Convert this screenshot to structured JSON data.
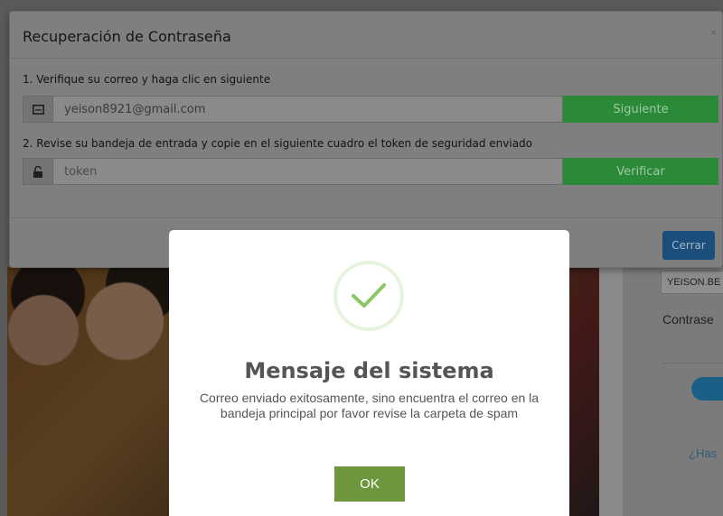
{
  "background": {
    "username": "YEISON.BE",
    "password_label": "Contrase",
    "link_text": "¿Has"
  },
  "recovery_modal": {
    "title": "Recuperación de Contraseña",
    "close_glyph": "×",
    "step1_label": "1. Verifique su correo y haga clic en siguiente",
    "email_value": "yeison8921@gmail.com",
    "next_button": "Siguiente",
    "step2_label": "2. Revise su bandeja de entrada y copie en el siguiente cuadro el token de seguridad enviado",
    "token_placeholder": "token",
    "verify_button": "Verificar",
    "close_button": "Cerrar",
    "icons": [
      "envelope-icon",
      "unlock-icon"
    ]
  },
  "alert": {
    "icon": "success-check-icon",
    "title": "Mensaje del sistema",
    "message": "Correo enviado exitosamente, sino encuentra el correo en la bandeja principal por favor revise la carpeta de spam",
    "ok_button": "OK"
  },
  "colors": {
    "accent_green": "#6e963c",
    "verify_green": "#2a8a37",
    "close_blue": "#1b4e7b",
    "check_green": "#8cc766"
  }
}
